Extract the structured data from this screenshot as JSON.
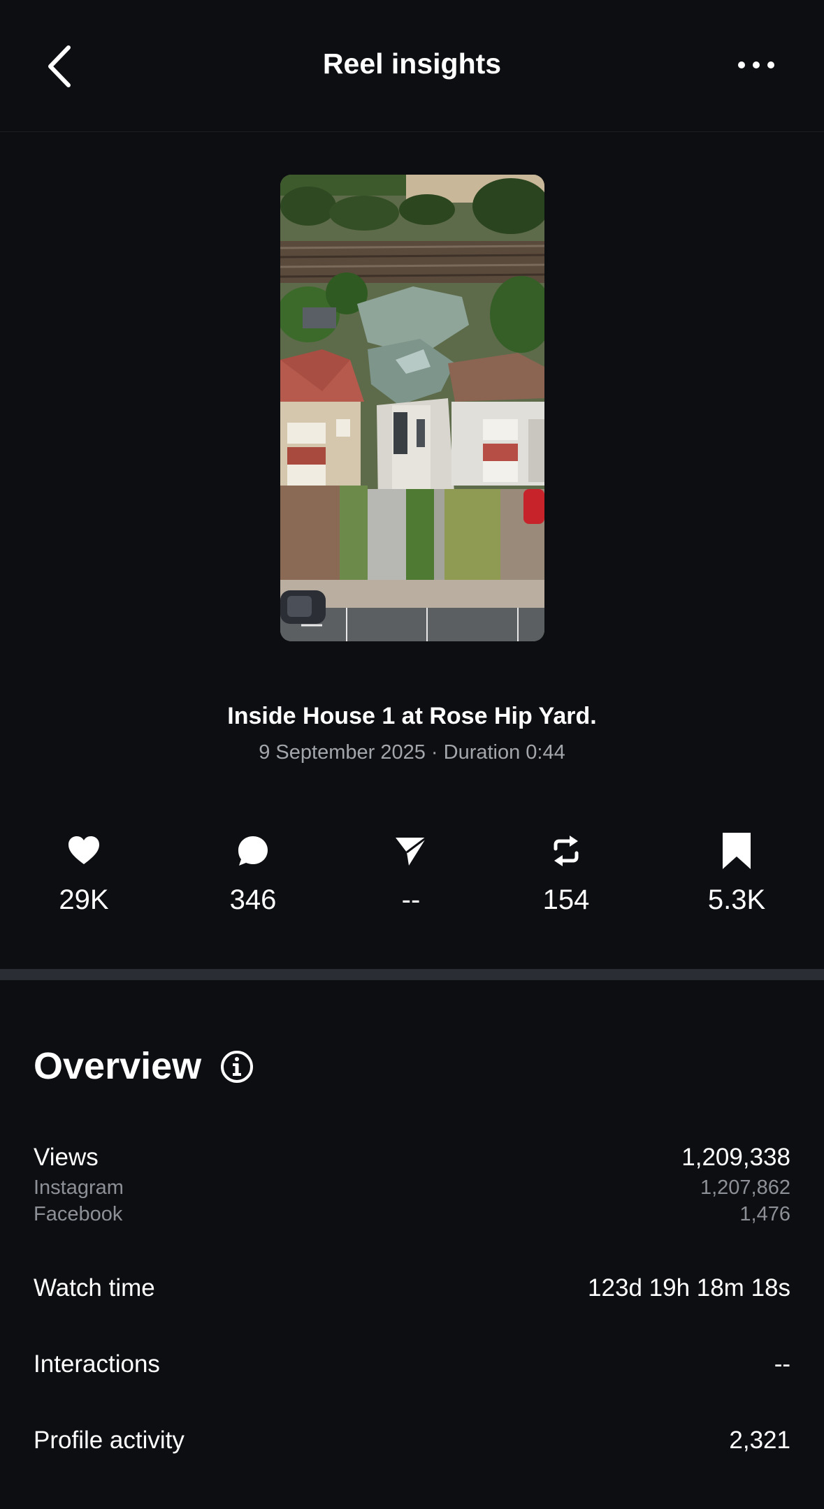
{
  "header": {
    "title": "Reel insights",
    "back_icon": "chevron-left-icon",
    "more_icon": "more-horizontal-icon"
  },
  "reel": {
    "thumbnail_alt": "Aerial view of houses",
    "caption": "Inside House 1 at Rose Hip Yard.",
    "meta": "9 September 2025 · Duration 0:44"
  },
  "stats": [
    {
      "icon": "heart-icon",
      "value": "29K"
    },
    {
      "icon": "comment-icon",
      "value": "346"
    },
    {
      "icon": "share-icon",
      "value": "--"
    },
    {
      "icon": "repost-icon",
      "value": "154"
    },
    {
      "icon": "bookmark-icon",
      "value": "5.3K"
    }
  ],
  "overview": {
    "title": "Overview",
    "info_icon": "info-icon",
    "views": {
      "label": "Views",
      "value": "1,209,338",
      "breakdown": [
        {
          "label": "Instagram",
          "value": "1,207,862"
        },
        {
          "label": "Facebook",
          "value": "1,476"
        }
      ]
    },
    "watch_time": {
      "label": "Watch time",
      "value": "123d 19h 18m 18s"
    },
    "interactions": {
      "label": "Interactions",
      "value": "--"
    },
    "profile_activity": {
      "label": "Profile activity",
      "value": "2,321"
    }
  },
  "colors": {
    "background": "#0c0e12",
    "divider": "#2a2e34",
    "text_primary": "#ffffff",
    "text_secondary": "#a3a6ab"
  }
}
